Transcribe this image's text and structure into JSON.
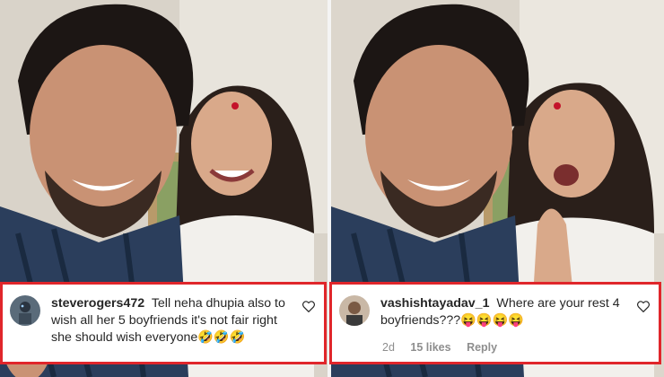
{
  "left_comment": {
    "username": "steverogers472",
    "text": "Tell neha dhupia also to wish all her 5 boyfriends it's not fair right she should wish everyone🤣🤣🤣"
  },
  "right_comment": {
    "username": "vashishtayadav_1",
    "text": "Where are your rest 4 boyfriends???😝😝😝😝",
    "time": "2d",
    "likes": "15 likes",
    "reply": "Reply"
  },
  "icons": {
    "heart": "heart-outline-icon"
  },
  "colors": {
    "highlight_border": "#e0262b",
    "username": "#262626",
    "meta": "#8e8e8e"
  }
}
